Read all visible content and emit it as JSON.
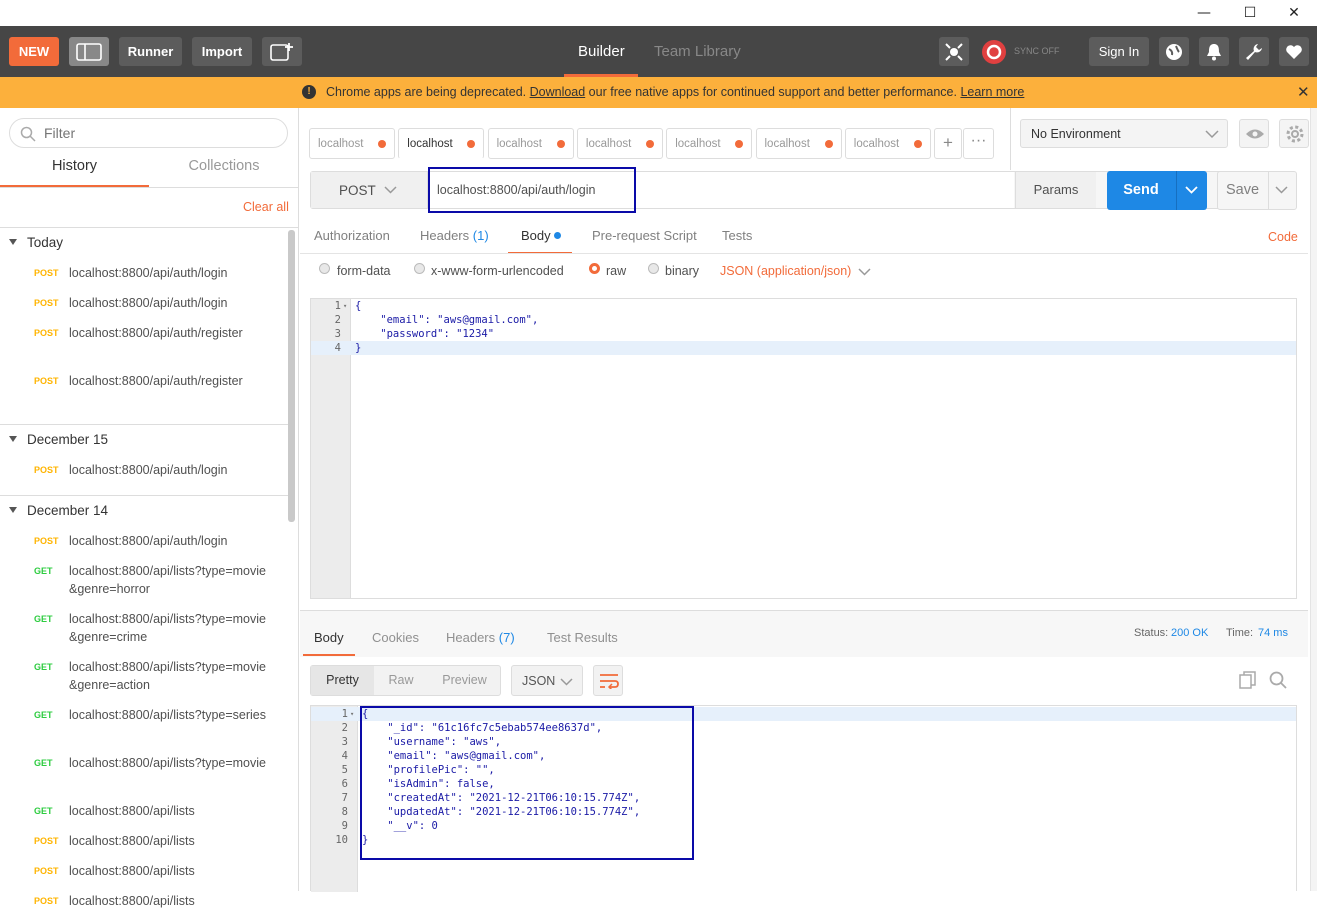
{
  "window": {
    "minimize": "—",
    "maximize": "☐",
    "close": "✕"
  },
  "header": {
    "new_label": "NEW",
    "runner_label": "Runner",
    "import_label": "Import",
    "tabs": [
      "Builder",
      "Team Library"
    ],
    "sync_label": "SYNC OFF",
    "signin_label": "Sign In"
  },
  "banner": {
    "text_before": "Chrome apps are being deprecated. ",
    "download_link": "Download",
    "text_middle": " our free native apps for continued support and better performance. ",
    "learn_link": "Learn more"
  },
  "sidebar": {
    "filter_placeholder": "Filter",
    "tabs": [
      "History",
      "Collections"
    ],
    "clear_all": "Clear all",
    "groups": [
      {
        "title": "Today",
        "items": [
          {
            "method": "POST",
            "url": "localhost:8800/api/auth/login"
          },
          {
            "method": "POST",
            "url": "localhost:8800/api/auth/login"
          },
          {
            "method": "POST",
            "url": "localhost:8800/api/auth/register"
          },
          {
            "method": "POST",
            "url": "localhost:8800/api/auth/register"
          }
        ]
      },
      {
        "title": "December 15",
        "items": [
          {
            "method": "POST",
            "url": "localhost:8800/api/auth/login"
          }
        ]
      },
      {
        "title": "December 14",
        "items": [
          {
            "method": "POST",
            "url": "localhost:8800/api/auth/login"
          },
          {
            "method": "GET",
            "url": "localhost:8800/api/lists?type=movie&genre=horror"
          },
          {
            "method": "GET",
            "url": "localhost:8800/api/lists?type=movie&genre=crime"
          },
          {
            "method": "GET",
            "url": "localhost:8800/api/lists?type=movie&genre=action"
          },
          {
            "method": "GET",
            "url": "localhost:8800/api/lists?type=series"
          },
          {
            "method": "GET",
            "url": "localhost:8800/api/lists?type=movie"
          },
          {
            "method": "GET",
            "url": "localhost:8800/api/lists"
          },
          {
            "method": "POST",
            "url": "localhost:8800/api/lists"
          },
          {
            "method": "POST",
            "url": "localhost:8800/api/lists"
          },
          {
            "method": "POST",
            "url": "localhost:8800/api/lists"
          }
        ]
      }
    ]
  },
  "request_tabs": [
    "localhost",
    "localhost",
    "localhost",
    "localhost",
    "localhost",
    "localhost",
    "localhost"
  ],
  "environment": "No Environment",
  "request": {
    "method": "POST",
    "url": "localhost:8800/api/auth/login",
    "params_label": "Params",
    "send_label": "Send",
    "save_label": "Save",
    "subtabs": [
      "Authorization",
      "Headers",
      "Body",
      "Pre-request Script",
      "Tests"
    ],
    "headers_count": "(1)",
    "code_link": "Code",
    "body_modes": [
      "form-data",
      "x-www-form-urlencoded",
      "raw",
      "binary"
    ],
    "content_type": "JSON (application/json)",
    "body_lines": [
      "{",
      "    \"email\": \"aws@gmail.com\",",
      "    \"password\": \"1234\"",
      "}"
    ]
  },
  "response": {
    "subtabs": [
      "Body",
      "Cookies",
      "Headers",
      "Test Results"
    ],
    "headers_count": "(7)",
    "status_label": "Status:",
    "status_value": "200 OK",
    "time_label": "Time:",
    "time_value": "74 ms",
    "view_modes": [
      "Pretty",
      "Raw",
      "Preview"
    ],
    "format": "JSON",
    "body_lines": [
      "{",
      "    \"_id\": \"61c16fc7c5ebab574ee8637d\",",
      "    \"username\": \"aws\",",
      "    \"email\": \"aws@gmail.com\",",
      "    \"profilePic\": \"\",",
      "    \"isAdmin\": false,",
      "    \"createdAt\": \"2021-12-21T06:10:15.774Z\",",
      "    \"updatedAt\": \"2021-12-21T06:10:15.774Z\",",
      "    \"__v\": 0",
      "}"
    ]
  },
  "colors": {
    "accent": "#f26b3a",
    "send": "#1e88e5",
    "banner": "#fcb03c",
    "header": "#464646",
    "post": "#ffb400",
    "get": "#2ecc40",
    "highlight_box": "#0a0aa8"
  }
}
